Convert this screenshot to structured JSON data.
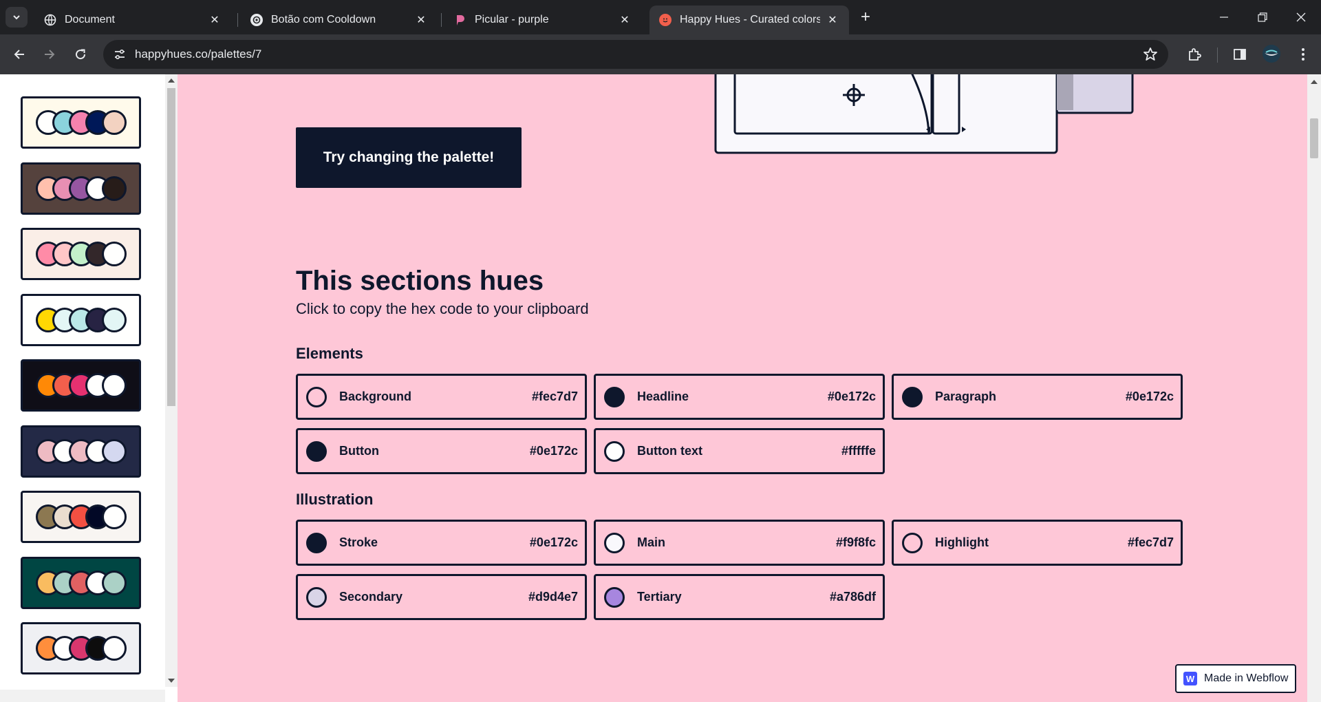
{
  "browser": {
    "tabs": [
      {
        "title": "Document",
        "favicon": "globe-icon"
      },
      {
        "title": "Botão com Cooldown",
        "favicon": "chatgpt-icon"
      },
      {
        "title": "Picular - purple",
        "favicon": "picular-icon"
      },
      {
        "title": "Happy Hues - Curated colors in",
        "favicon": "happy-hues-icon",
        "active": true
      }
    ],
    "url": "happyhues.co/palettes/7"
  },
  "sidebar": {
    "palettes": [
      {
        "bg": "#fffaeb",
        "colors": [
          "#fffffe",
          "#8bd3dd",
          "#f582ae",
          "#001858",
          "#f3d2c1"
        ]
      },
      {
        "bg": "#55423d",
        "colors": [
          "#ffc0ad",
          "#e78fb3",
          "#9656a1",
          "#fffffe",
          "#271c19"
        ]
      },
      {
        "bg": "#faeee7",
        "colors": [
          "#ff8ba7",
          "#ffc6c7",
          "#c3f0ca",
          "#33272a",
          "#fffffe"
        ]
      },
      {
        "bg": "#fffffe",
        "colors": [
          "#ffd803",
          "#e3f6f5",
          "#bae8e8",
          "#272343",
          "#e3f6f5"
        ]
      },
      {
        "bg": "#0f0e17",
        "colors": [
          "#ff8906",
          "#f25f4c",
          "#e53170",
          "#fffffe",
          "#fffffe"
        ]
      },
      {
        "bg": "#232946",
        "colors": [
          "#eebbc3",
          "#fffffe",
          "#eebbc3",
          "#fffffe",
          "#d4d8f0"
        ]
      },
      {
        "bg": "#f8f5f2",
        "colors": [
          "#8c7851",
          "#eaddcf",
          "#f25042",
          "#020826",
          "#fffffe"
        ]
      },
      {
        "bg": "#004643",
        "colors": [
          "#f9bc60",
          "#abd1c6",
          "#e16162",
          "#fffffe",
          "#abd1c6"
        ]
      },
      {
        "bg": "#eff0f3",
        "colors": [
          "#ff8e3c",
          "#fffffe",
          "#d9376e",
          "#0d0d0d",
          "#fffffe"
        ]
      }
    ]
  },
  "main": {
    "cta_label": "Try changing the palette!",
    "section_title": "This sections hues",
    "section_subtitle": "Click to copy the hex code to your clipboard",
    "elements_label": "Elements",
    "elements": [
      {
        "name": "Background",
        "hex": "#fec7d7"
      },
      {
        "name": "Headline",
        "hex": "#0e172c"
      },
      {
        "name": "Paragraph",
        "hex": "#0e172c"
      },
      {
        "name": "Button",
        "hex": "#0e172c"
      },
      {
        "name": "Button text",
        "hex": "#fffffe"
      }
    ],
    "illustration_label": "Illustration",
    "illustration": [
      {
        "name": "Stroke",
        "hex": "#0e172c"
      },
      {
        "name": "Main",
        "hex": "#f9f8fc"
      },
      {
        "name": "Highlight",
        "hex": "#fec7d7"
      },
      {
        "name": "Secondary",
        "hex": "#d9d4e7"
      },
      {
        "name": "Tertiary",
        "hex": "#a786df"
      }
    ]
  },
  "badge": {
    "label": "Made in Webflow",
    "logo_letter": "W"
  }
}
